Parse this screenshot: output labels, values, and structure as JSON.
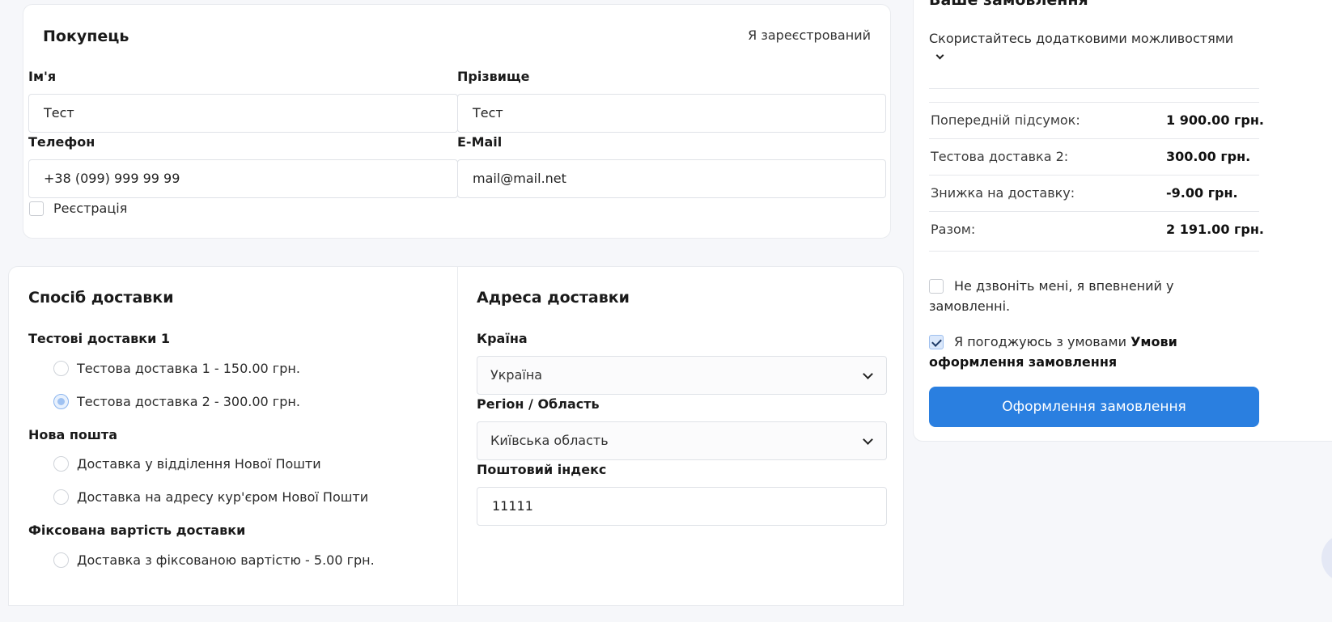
{
  "buyer": {
    "title": "Покупець",
    "registered_link": "Я зареєстрований",
    "first_name_label": "Ім'я",
    "first_name_value": "Тест",
    "last_name_label": "Прізвище",
    "last_name_value": "Тест",
    "phone_label": "Телефон",
    "phone_value": "+38 (099) 999 99 99",
    "email_label": "E-Mail",
    "email_value": "mail@mail.net",
    "register_label": "Реєстрація",
    "register_checked": false
  },
  "delivery": {
    "title": "Спосіб доставки",
    "groups": [
      {
        "title": "Тестові доставки 1",
        "options": [
          {
            "label": "Тестова доставка 1 - 150.00 грн.",
            "selected": false
          },
          {
            "label": "Тестова доставка 2 - 300.00 грн.",
            "selected": true
          }
        ]
      },
      {
        "title": "Нова пошта",
        "options": [
          {
            "label": "Доставка у відділення Нової Пошти",
            "selected": false
          },
          {
            "label": "Доставка на адресу кур'єром Нової Пошти",
            "selected": false
          }
        ]
      },
      {
        "title": "Фіксована вартість доставки",
        "options": [
          {
            "label": "Доставка з фіксованою вартістю - 5.00 грн.",
            "selected": false
          }
        ]
      }
    ]
  },
  "address": {
    "title": "Адреса доставки",
    "country_label": "Країна",
    "country_value": "Україна",
    "region_label": "Регіон / Область",
    "region_value": "Київська область",
    "postcode_label": "Поштовий індекс",
    "postcode_value": "11111"
  },
  "order": {
    "title": "Ваше замовлення",
    "extra_options": "Скористайтесь додатковими можливостями",
    "summary": [
      {
        "label": "Попередній підсумок:",
        "value": "1 900.00 грн."
      },
      {
        "label": "Тестова доставка 2:",
        "value": "300.00 грн."
      },
      {
        "label": "Знижка на доставку:",
        "value": "-9.00 грн."
      },
      {
        "label": "Разом:",
        "value": "2 191.00 грн."
      }
    ],
    "no_call_text": "Не дзвоніть мені, я впевнений у замовленні.",
    "no_call_checked": false,
    "agree_text": "Я погоджуюсь з умовами",
    "agree_link": "Умови оформлення замовлення",
    "agree_checked": true,
    "submit_label": "Оформлення замовлення"
  }
}
